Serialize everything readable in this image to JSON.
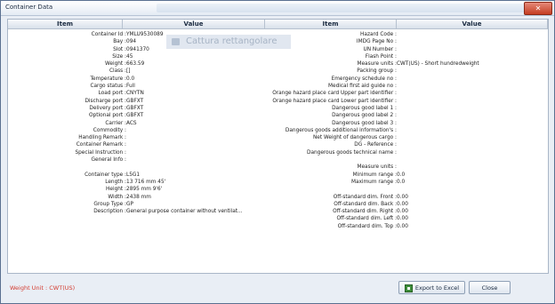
{
  "window": {
    "title": "Container Data",
    "close_glyph": "✕"
  },
  "columns": [
    "Item",
    "Value",
    "Item",
    "Value"
  ],
  "overlay_text": "Cattura rettangolare",
  "left_rows": [
    {
      "label": "Container Id",
      "value": "YMLU9530089"
    },
    {
      "label": "Bay",
      "value": "094"
    },
    {
      "label": "Slot",
      "value": "0941370"
    },
    {
      "label": "Size",
      "value": "45"
    },
    {
      "label": "Weight",
      "value": "663.59"
    },
    {
      "label": "Class",
      "value": "[]"
    },
    {
      "label": "Temperature",
      "value": "0.0"
    },
    {
      "label": "Cargo status",
      "value": "Full"
    },
    {
      "label": "Load port",
      "value": "CNYTN"
    },
    {
      "label": "Discharge port",
      "value": "GBFXT"
    },
    {
      "label": "Delivery port",
      "value": "GBFXT"
    },
    {
      "label": "Optional port",
      "value": "GBFXT"
    },
    {
      "label": "Carrier",
      "value": "ACS"
    },
    {
      "label": "Commodity",
      "value": ""
    },
    {
      "label": "Handling Remark",
      "value": ""
    },
    {
      "label": "Container Remark",
      "value": ""
    },
    {
      "label": "Special Instruction",
      "value": ""
    },
    {
      "label": "General Info",
      "value": ""
    },
    {
      "label": "",
      "value": ""
    },
    {
      "label": "Container type",
      "value": "L5G1"
    },
    {
      "label": "Length",
      "value": "13 716 mm 45'"
    },
    {
      "label": "Height",
      "value": "2895 mm 9'6'"
    },
    {
      "label": "Width",
      "value": "2438 mm"
    },
    {
      "label": "Group Type",
      "value": "GP"
    },
    {
      "label": "Description",
      "value": "General purpose container without ventilat..."
    }
  ],
  "right_rows": [
    {
      "label": "Hazard Code",
      "value": ""
    },
    {
      "label": "IMDG Page No",
      "value": ""
    },
    {
      "label": "UN Number",
      "value": ""
    },
    {
      "label": "Flash Point",
      "value": ""
    },
    {
      "label": "Measure units",
      "value": "CWT(US) - Short hundredweight"
    },
    {
      "label": "Packing group",
      "value": ""
    },
    {
      "label": "Emergency schedule no",
      "value": ""
    },
    {
      "label": "Medical first aid guide no",
      "value": ""
    },
    {
      "label": "Orange hazard place card Upper part identifier",
      "value": ""
    },
    {
      "label": "Orange hazard place card Lower part identifier",
      "value": ""
    },
    {
      "label": "Dangerous good label 1",
      "value": ""
    },
    {
      "label": "Dangerous good label 2",
      "value": ""
    },
    {
      "label": "Dangerous good label 3",
      "value": ""
    },
    {
      "label": "Dangerous goods additional information's",
      "value": ""
    },
    {
      "label": "Net Weight of dangerous cargo",
      "value": ""
    },
    {
      "label": "DG - Reference",
      "value": ""
    },
    {
      "label": "Dangerous goods technical name",
      "value": ""
    },
    {
      "label": "",
      "value": ""
    },
    {
      "label": "Measure units",
      "value": ""
    },
    {
      "label": "Minimum range",
      "value": "0.0"
    },
    {
      "label": "Maximum range",
      "value": "0.0"
    },
    {
      "label": "",
      "value": ""
    },
    {
      "label": "Off-standard dim. Front",
      "value": "0.00"
    },
    {
      "label": "Off-standard dim. Back",
      "value": "0.00"
    },
    {
      "label": "Off-standard dim. Right",
      "value": "0.00"
    },
    {
      "label": "Off-standard dim. Left",
      "value": "0.00"
    },
    {
      "label": "Off-standard dim. Top",
      "value": "0.00"
    }
  ],
  "footer": {
    "weight_unit": "Weight Unit : CWT(US)",
    "export_label": "Export to Excel",
    "close_label": "Close"
  }
}
